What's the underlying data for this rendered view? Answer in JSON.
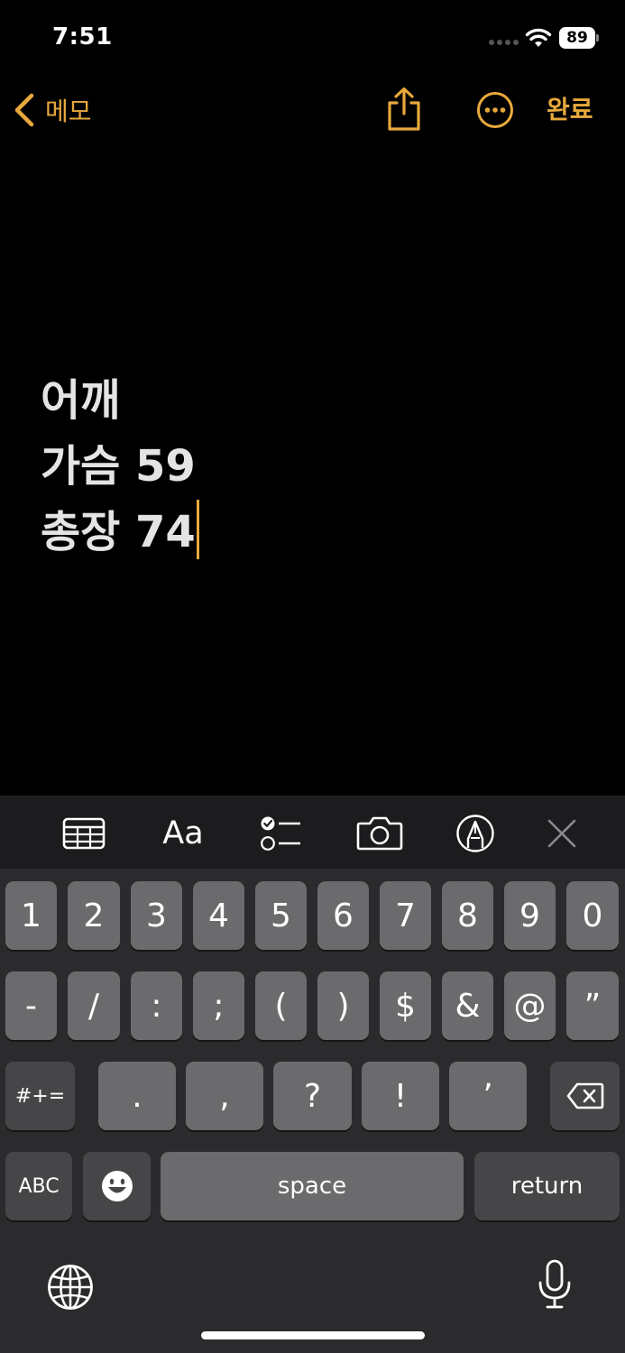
{
  "status_bar": {
    "time": "7:51",
    "battery": "89"
  },
  "nav": {
    "back_label": "메모",
    "done_label": "완료"
  },
  "note": {
    "lines": [
      "어깨",
      "가슴 59",
      "총장 74"
    ]
  },
  "toolbar": {
    "aa_label": "Aa",
    "icons": [
      "table-icon",
      "format-text-icon",
      "checklist-icon",
      "camera-icon",
      "markup-pen-icon",
      "close-icon"
    ]
  },
  "keyboard": {
    "row1": [
      "1",
      "2",
      "3",
      "4",
      "5",
      "6",
      "7",
      "8",
      "9",
      "0"
    ],
    "row2": [
      "-",
      "/",
      ":",
      ";",
      "(",
      ")",
      "$",
      "&",
      "@",
      "”"
    ],
    "row3": [
      ".",
      ",",
      "?",
      "!",
      "’"
    ],
    "mode_symbols": "#+=",
    "mode_abc": "ABC",
    "space": "space",
    "return": "return"
  },
  "colors": {
    "accent": "#e8a93c",
    "key": "#6b6b6d",
    "key_dark": "#464648",
    "keyboard_bg": "#2b2b2d"
  }
}
